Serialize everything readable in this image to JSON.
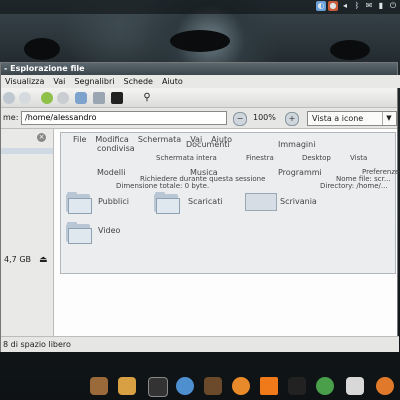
{
  "window": {
    "title": "- Esplorazione file",
    "menu": [
      "Visualizza",
      "Vai",
      "Segnalibri",
      "Schede",
      "Aiuto"
    ]
  },
  "location": {
    "label": "me:",
    "path": "/home/alessandro",
    "zoom": "100%",
    "view_mode": "Vista a icone"
  },
  "sidebar": {
    "size": "4,7 GB"
  },
  "statusbar": {
    "text": "8 di spazio libero"
  },
  "ghost": {
    "menu": [
      "File",
      "Modifica",
      "Schermata",
      "Vai",
      "Aiuto"
    ],
    "row_labels": [
      "Documenti",
      "Immagini",
      "Musica",
      "Programmi",
      "Modelli",
      "Preferenze",
      "condivisa"
    ],
    "small_labels": [
      "Schermata intera",
      "Finestra",
      "Desktop",
      "Vista"
    ],
    "info": [
      "Dimensione totale: 0 byte.",
      "Richiedere durante questa sessione",
      "Nome file: scr...",
      "Directory: /home/..."
    ]
  },
  "folders": [
    {
      "label": "Pubblici"
    },
    {
      "label": "Scaricati"
    },
    {
      "label": "Scrivania"
    },
    {
      "label": "Video"
    }
  ]
}
